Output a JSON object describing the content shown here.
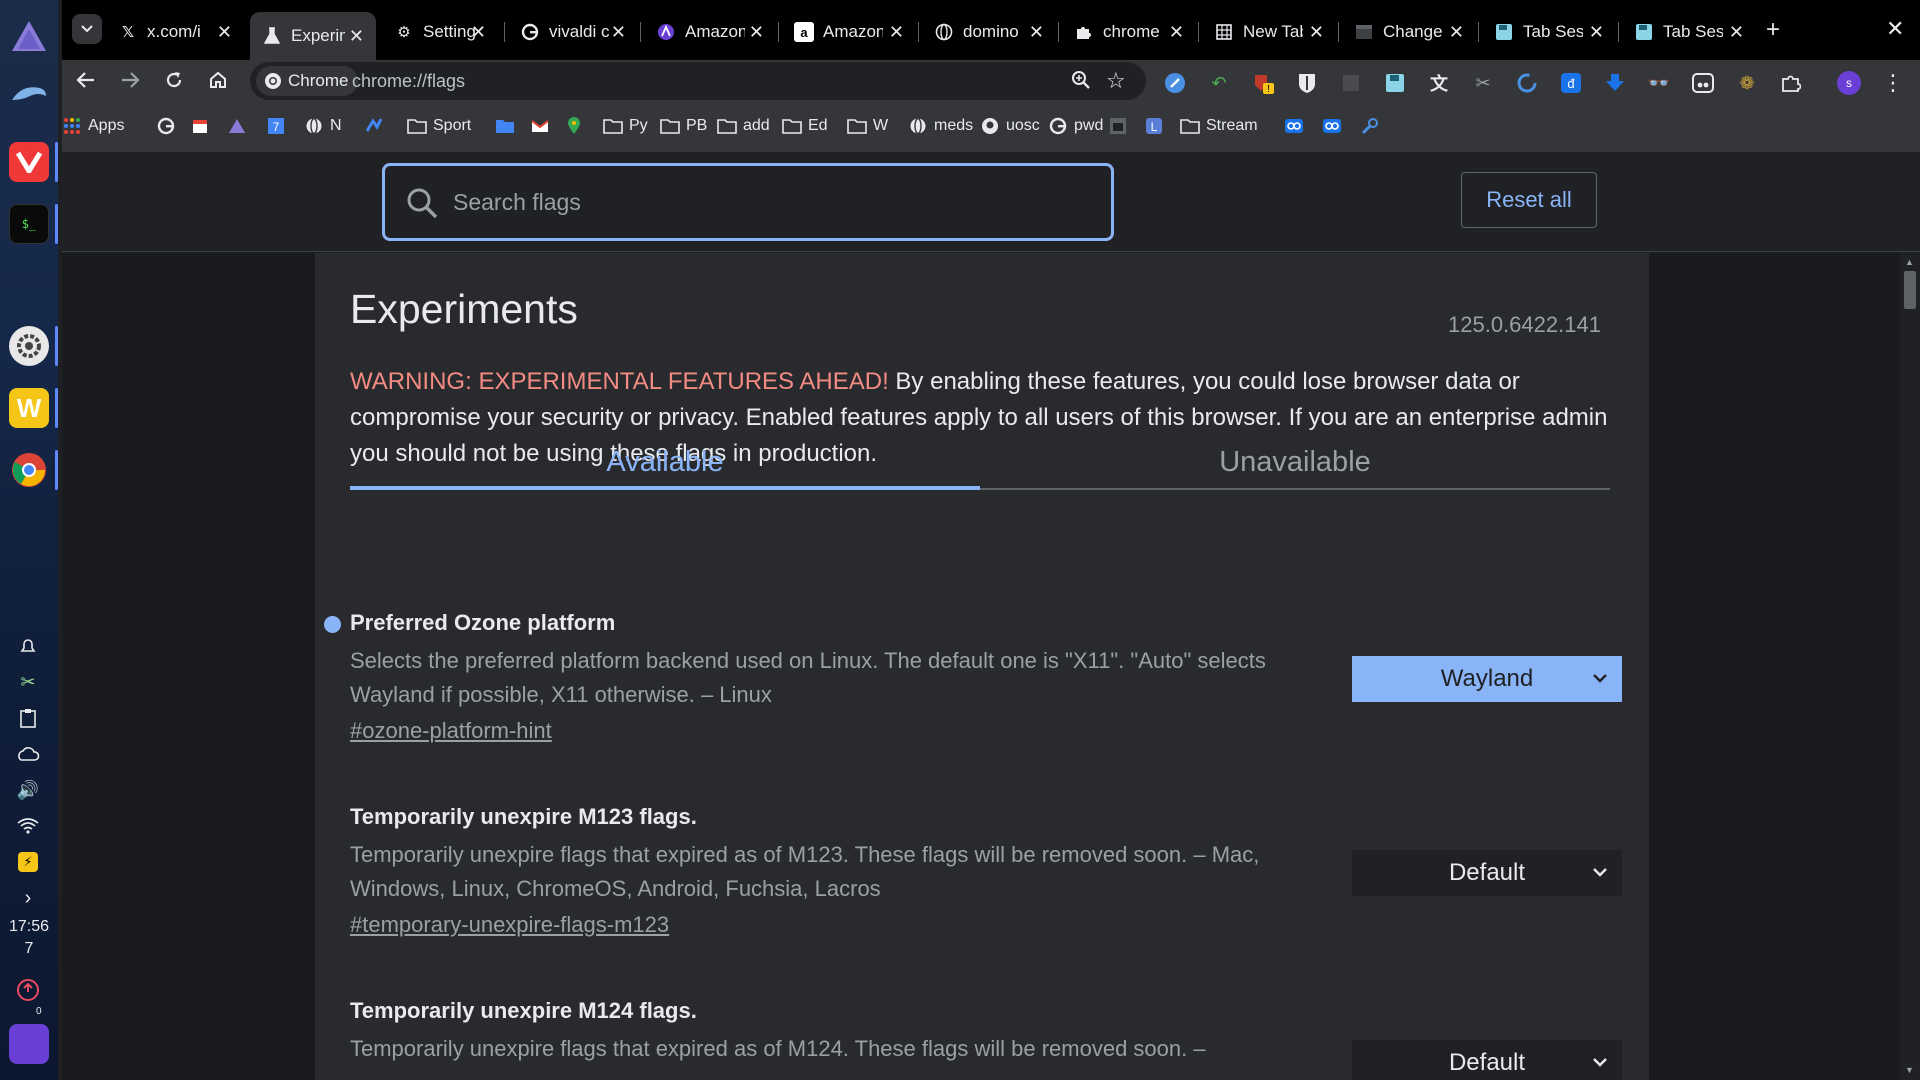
{
  "dock": {
    "clock_time": "17:56",
    "clock_day": "7",
    "notification_count": "0"
  },
  "tabs": [
    {
      "title": "x.com/i",
      "icon": "x-icon"
    },
    {
      "title": "Experiments",
      "icon": "flask-icon",
      "active": true
    },
    {
      "title": "Settings",
      "icon": "gear-icon"
    },
    {
      "title": "vivaldi c",
      "icon": "google-icon"
    },
    {
      "title": "Amazon",
      "icon": "aria-icon"
    },
    {
      "title": "Amazon",
      "icon": "amazon-icon"
    },
    {
      "title": "domino",
      "icon": "globe-icon"
    },
    {
      "title": "chrome",
      "icon": "puzzle-icon"
    },
    {
      "title": "New Tab",
      "icon": "grid-icon"
    },
    {
      "title": "Change",
      "icon": "page-icon"
    },
    {
      "title": "Tab Session",
      "icon": "save-icon"
    },
    {
      "title": "Tab Session",
      "icon": "save-icon"
    }
  ],
  "omnibox": {
    "site_chip": "Chrome",
    "url": "chrome://flags"
  },
  "bookmarks": [
    {
      "label": "Apps",
      "icon": "apps-grid-icon"
    },
    {
      "label": "",
      "icon": "google-icon"
    },
    {
      "label": "",
      "icon": "calendar-icon"
    },
    {
      "label": "",
      "icon": "triangle-icon"
    },
    {
      "label": "",
      "icon": "seven-icon"
    },
    {
      "label": "N",
      "icon": "globe-icon"
    },
    {
      "label": "",
      "icon": "chart-icon"
    },
    {
      "label": "Sport",
      "icon": "folder-icon"
    },
    {
      "label": "",
      "icon": "blue-folder-icon"
    },
    {
      "label": "",
      "icon": "gmail-icon"
    },
    {
      "label": "",
      "icon": "maps-icon"
    },
    {
      "label": "Py",
      "icon": "folder-icon"
    },
    {
      "label": "PB",
      "icon": "folder-icon"
    },
    {
      "label": "add",
      "icon": "folder-icon"
    },
    {
      "label": "Ed",
      "icon": "folder-icon"
    },
    {
      "label": "W",
      "icon": "folder-icon"
    },
    {
      "label": "meds",
      "icon": "globe-icon"
    },
    {
      "label": "uosc",
      "icon": "github-icon"
    },
    {
      "label": "pwd",
      "icon": "google-icon"
    },
    {
      "label": "",
      "icon": "image-icon"
    },
    {
      "label": "",
      "icon": "l-icon"
    },
    {
      "label": "Stream",
      "icon": "folder-icon"
    },
    {
      "label": "",
      "icon": "link-icon"
    },
    {
      "label": "",
      "icon": "link-icon"
    },
    {
      "label": "",
      "icon": "steam-icon"
    }
  ],
  "search": {
    "placeholder": "Search flags",
    "reset_label": "Reset all"
  },
  "experiments": {
    "title": "Experiments",
    "version": "125.0.6422.141",
    "warning_prefix": "WARNING: EXPERIMENTAL FEATURES AHEAD!",
    "warning_text": " By enabling these features, you could lose browser data or compromise your security or privacy. Enabled features apply to all users of this browser. If you are an enterprise admin you should not be using these flags in production.",
    "tab_available": "Available",
    "tab_unavailable": "Unavailable"
  },
  "flags": [
    {
      "title": "Preferred Ozone platform",
      "description": "Selects the preferred platform backend used on Linux. The default one is \"X11\". \"Auto\" selects Wayland if possible, X11 otherwise. – Linux",
      "link": "#ozone-platform-hint",
      "value": "Wayland",
      "modified": true
    },
    {
      "title": "Temporarily unexpire M123 flags.",
      "description": "Temporarily unexpire flags that expired as of M123. These flags will be removed soon. – Mac, Windows, Linux, ChromeOS, Android, Fuchsia, Lacros",
      "link": "#temporary-unexpire-flags-m123",
      "value": "Default",
      "modified": false
    },
    {
      "title": "Temporarily unexpire M124 flags.",
      "description": "Temporarily unexpire flags that expired as of M124. These flags will be removed soon. –",
      "link": "",
      "value": "Default",
      "modified": false
    }
  ],
  "colors": {
    "accent": "#8ab4f8",
    "warning": "#f28b82",
    "background": "#202124",
    "card": "#292a2d"
  }
}
